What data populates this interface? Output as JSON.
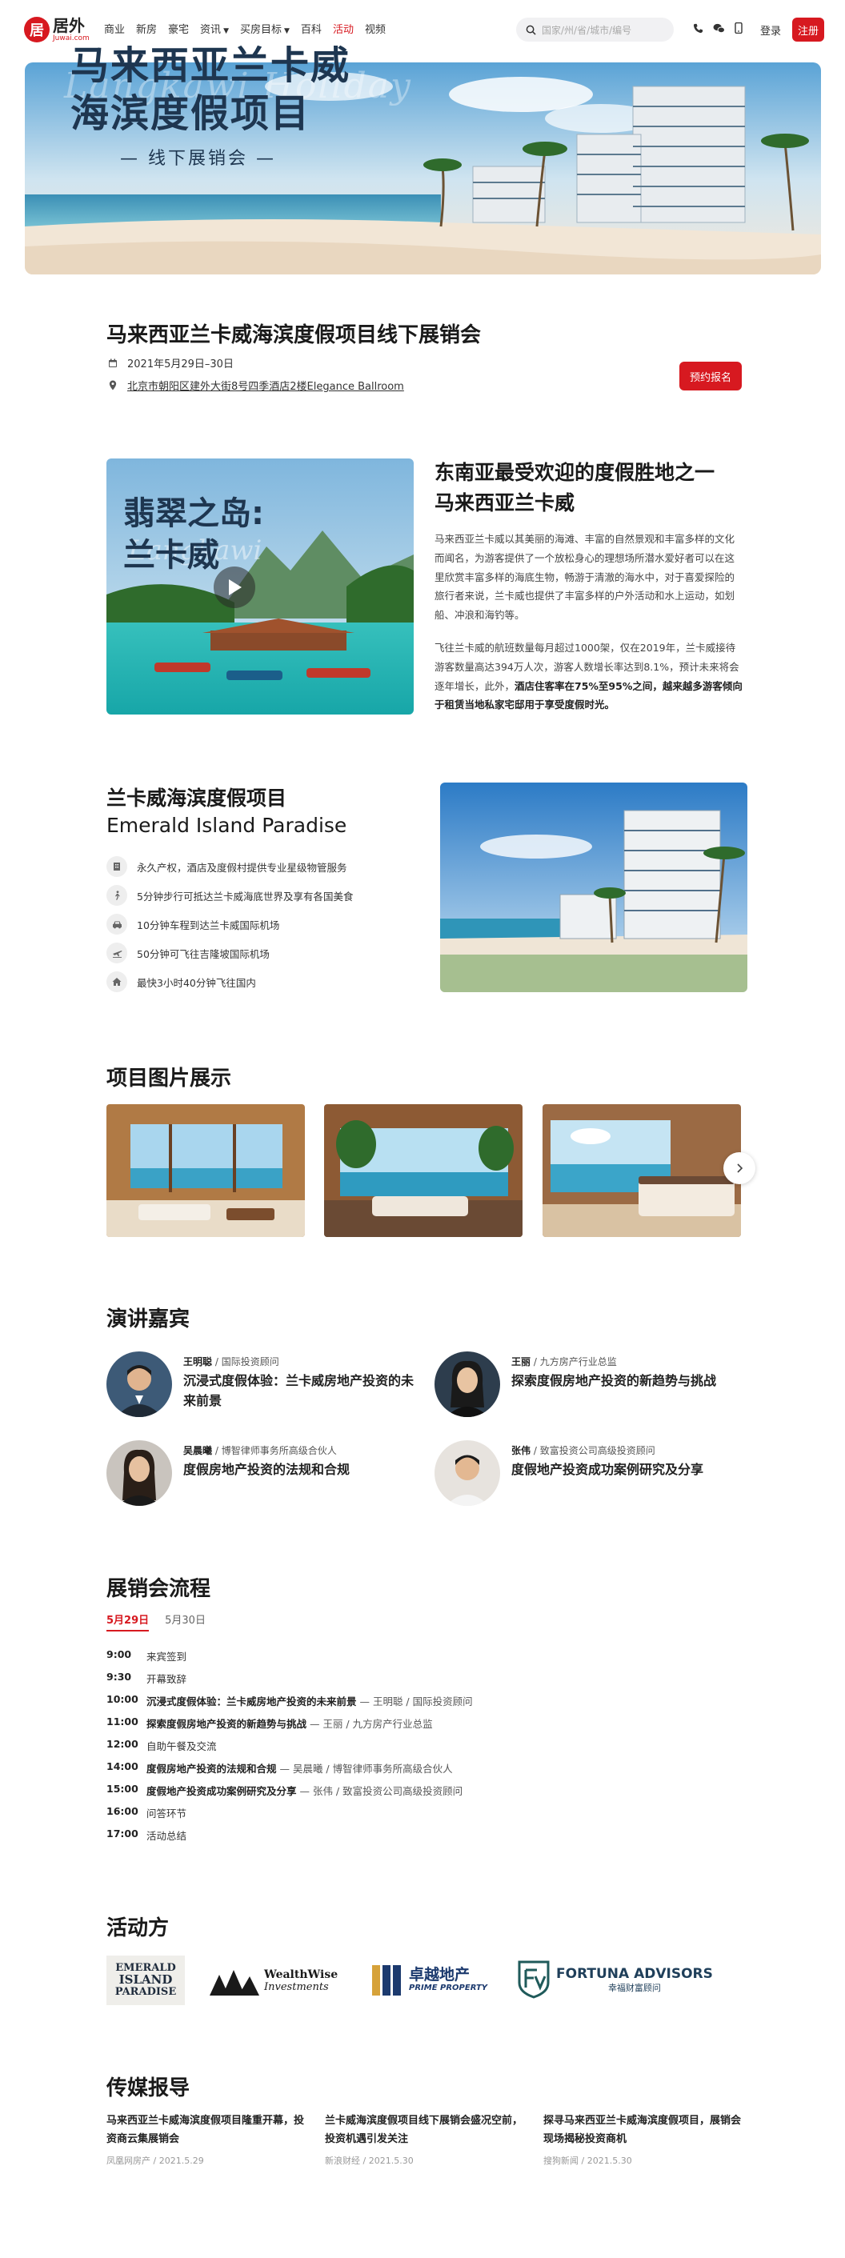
{
  "nav": {
    "logo_cn": "居外",
    "logo_en": "Juwai.com",
    "links": [
      "商业",
      "新房",
      "豪宅",
      "资讯",
      "买房目标",
      "百科",
      "活动",
      "视频"
    ],
    "active_link": "活动",
    "search_placeholder": "国家/州/省/城市/编号",
    "login": "登录",
    "register": "注册"
  },
  "hero": {
    "title_line1": "马来西亚兰卡威",
    "title_line2": "海滨度假项目",
    "script": "Langkawi  Holiday",
    "subtitle": "— 线下展销会 —"
  },
  "event": {
    "title": "马来西亚兰卡威海滨度假项目线下展销会",
    "date": "2021年5月29日–30日",
    "address": "北京市朝阳区建外大街8号四季酒店2楼Elegance Ballroom",
    "book_button": "预约报名"
  },
  "intro": {
    "video_title_line1": "翡翠之岛:",
    "video_title_line2": "兰卡威",
    "video_script": "Langkawi",
    "heading_line1": "东南亚最受欢迎的度假胜地之一",
    "heading_line2": "马来西亚兰卡威",
    "para1": "马来西亚兰卡威以其美丽的海滩、丰富的自然景观和丰富多样的文化而闻名，为游客提供了一个放松身心的理想场所潜水爱好者可以在这里欣赏丰富多样的海底生物，畅游于清澈的海水中，对于喜爱探险的旅行者来说，兰卡威也提供了丰富多样的户外活动和水上运动，如划船、冲浪和海钓等。",
    "para2_normal": "飞往兰卡威的航班数量每月超过1000架，仅在2019年，兰卡威接待游客数量高达394万人次，游客人数增长率达到8.1%，预计未来将会逐年增长，此外，",
    "para2_bold": "酒店住客率在75%至95%之间，越来越多游客倾向于租赁当地私家宅邸用于享受度假时光。"
  },
  "project": {
    "title_cn": "兰卡威海滨度假项目",
    "title_en": "Emerald Island Paradise",
    "features": [
      {
        "icon": "building-icon",
        "text": "永久产权，酒店及度假村提供专业星级物管服务"
      },
      {
        "icon": "walking-icon",
        "text": "5分钟步行可抵达兰卡威海底世界及享有各国美食"
      },
      {
        "icon": "car-icon",
        "text": "10分钟车程到达兰卡威国际机场"
      },
      {
        "icon": "plane-icon",
        "text": "50分钟可飞往吉隆坡国际机场"
      },
      {
        "icon": "home-icon",
        "text": "最快3小时40分钟飞往国内"
      }
    ]
  },
  "gallery": {
    "title": "项目图片展示"
  },
  "speakers": {
    "title": "演讲嘉宾",
    "items": [
      {
        "name": "王明聪",
        "role": "国际投资顾问",
        "talk": "沉浸式度假体验：兰卡威房地产投资的未来前景"
      },
      {
        "name": "王丽",
        "role": "九方房产行业总监",
        "talk": "探索度假房地产投资的新趋势与挑战"
      },
      {
        "name": "吴晨曦",
        "role": "博智律师事务所高级合伙人",
        "talk": "度假房地产投资的法规和合规"
      },
      {
        "name": "张伟",
        "role": "致富投资公司高级投资顾问",
        "talk": "度假地产投资成功案例研究及分享"
      }
    ]
  },
  "schedule": {
    "title": "展销会流程",
    "tabs": [
      "5月29日",
      "5月30日"
    ],
    "items": [
      {
        "time": "9:00",
        "talk": "",
        "text": "来宾签到",
        "who": ""
      },
      {
        "time": "9:30",
        "talk": "",
        "text": "开幕致辞",
        "who": ""
      },
      {
        "time": "10:00",
        "talk": "沉浸式度假体验：兰卡威房地产投资的未来前景",
        "text": "",
        "who": " — 王明聪 / 国际投资顾问"
      },
      {
        "time": "11:00",
        "talk": "探索度假房地产投资的新趋势与挑战",
        "text": "",
        "who": " — 王丽 / 九方房产行业总监"
      },
      {
        "time": "12:00",
        "talk": "",
        "text": "自助午餐及交流",
        "who": ""
      },
      {
        "time": "14:00",
        "talk": "度假房地产投资的法规和合规",
        "text": "",
        "who": " — 吴晨曦 / 博智律师事务所高级合伙人"
      },
      {
        "time": "15:00",
        "talk": "度假地产投资成功案例研究及分享",
        "text": "",
        "who": " — 张伟 / 致富投资公司高级投资顾问"
      },
      {
        "time": "16:00",
        "talk": "",
        "text": "问答环节",
        "who": ""
      },
      {
        "time": "17:00",
        "talk": "",
        "text": "活动总结",
        "who": ""
      }
    ]
  },
  "sponsors": {
    "title": "活动方",
    "items": [
      {
        "line1": "EMERALD",
        "line2": "ISLAND",
        "line3": "PARADISE"
      },
      {
        "line1": "WealthWise",
        "line2": "Investments"
      },
      {
        "line1": "卓越地产",
        "line2": "PRIME PROPERTY"
      },
      {
        "line1": "FORTUNA ADVISORS",
        "line2": "幸福财富顾问"
      }
    ]
  },
  "media": {
    "title": "传媒报导",
    "items": [
      {
        "title": "马来西亚兰卡威海滨度假项目隆重开幕，投资商云集展销会",
        "source": "凤凰网房产",
        "date": "2021.5.29"
      },
      {
        "title": "兰卡威海滨度假项目线下展销会盛况空前，投资机遇引发关注",
        "source": "新浪财经",
        "date": "2021.5.30"
      },
      {
        "title": "探寻马来西亚兰卡威海滨度假项目，展销会现场揭秘投资商机",
        "source": "搜狗新闻",
        "date": "2021.5.30"
      }
    ]
  },
  "colors": {
    "brand": "#d71920",
    "navy": "#1e3650"
  }
}
